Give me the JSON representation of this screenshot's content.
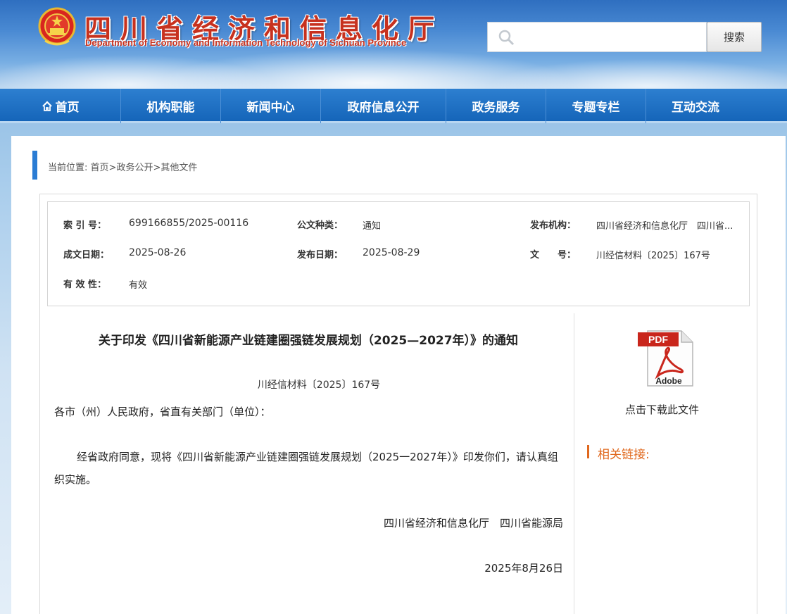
{
  "header": {
    "title": "四川省经济和信息化厅",
    "subtitle": "Department of Economy and Information Technology of Sichuan Province",
    "search_placeholder": "",
    "search_button": "搜索"
  },
  "nav": {
    "items": [
      {
        "label": "首页",
        "icon": "home-icon"
      },
      {
        "label": "机构职能"
      },
      {
        "label": "新闻中心"
      },
      {
        "label": "政府信息公开"
      },
      {
        "label": "政务服务"
      },
      {
        "label": "专题专栏"
      },
      {
        "label": "互动交流"
      }
    ]
  },
  "breadcrumb": {
    "prefix": "当前位置:",
    "items": [
      "首页",
      "政务公开",
      "其他文件"
    ],
    "separator": ">"
  },
  "meta": {
    "index_label": "索 引 号：",
    "index_value": "699166855/2025-00116",
    "type_label": "公文种类：",
    "type_value": "通知",
    "publisher_label": "发布机构：",
    "publisher_value": "四川省经济和信息化厅　四川省...",
    "created_label": "成文日期：",
    "created_value": "2025-08-26",
    "published_label": "发布日期：",
    "published_value": "2025-08-29",
    "docno_label": "文　　号：",
    "docno_value": "川经信材料〔2025〕167号",
    "validity_label": "有 效 性：",
    "validity_value": "有效"
  },
  "document": {
    "title": "关于印发《四川省新能源产业链建圈强链发展规划（2025—2027年）》的通知",
    "number": "川经信材料〔2025〕167号",
    "addressee": "各市（州）人民政府，省直有关部门（单位）：",
    "body": "经省政府同意，现将《四川省新能源产业链建圈强链发展规划（2025一2027年）》印发你们，请认真组织实施。",
    "signer": "四川省经济和信息化厅　四川省能源局",
    "date": "2025年8月26日"
  },
  "sidebar": {
    "pdf_label": "PDF",
    "pdf_brand": "Adobe",
    "download_label": "点击下载此文件",
    "related_title": "相关链接:"
  },
  "colors": {
    "nav_blue": "#1a6cc0",
    "title_red": "#c7311e",
    "accent_orange": "#e0681e"
  }
}
